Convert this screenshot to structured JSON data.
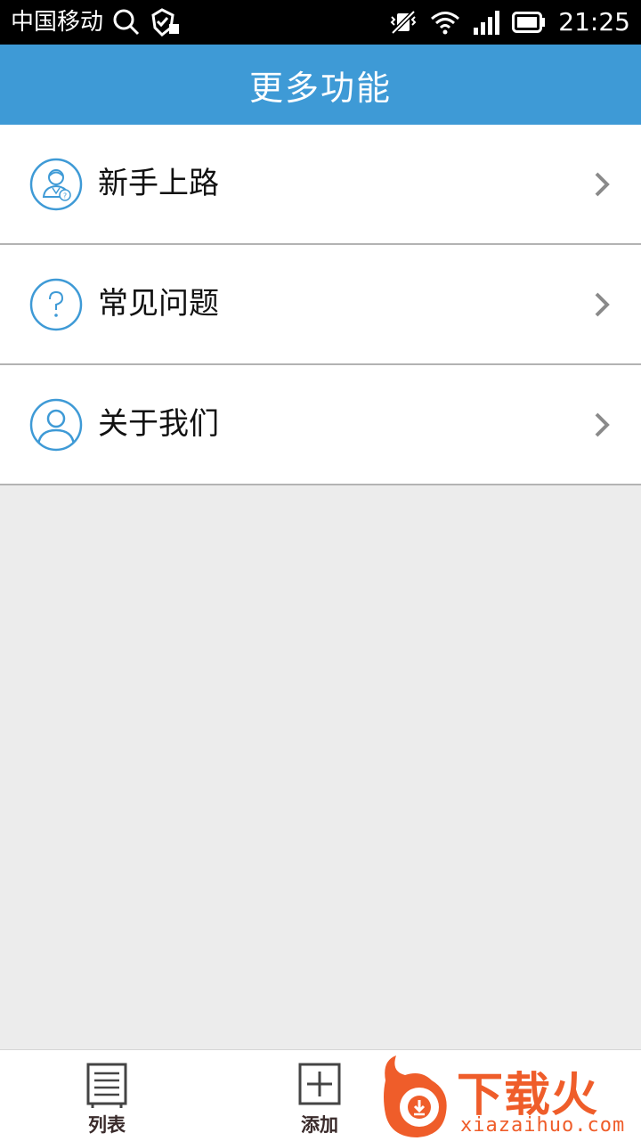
{
  "status_bar": {
    "carrier": "中国移动",
    "time": "21:25"
  },
  "header": {
    "title": "更多功能"
  },
  "menu": {
    "items": [
      {
        "label": "新手上路",
        "icon": "user-guide-icon"
      },
      {
        "label": "常见问题",
        "icon": "question-icon"
      },
      {
        "label": "关于我们",
        "icon": "person-icon"
      }
    ]
  },
  "tabbar": {
    "tabs": [
      {
        "label": "列表",
        "icon": "list-icon"
      },
      {
        "label": "添加",
        "icon": "add-icon"
      }
    ]
  },
  "watermark": {
    "text": "下载火",
    "url": "xiazaihuo.com"
  },
  "colors": {
    "accent": "#3e9ad6",
    "background": "#ececec",
    "watermark": "#ef5d2a"
  }
}
